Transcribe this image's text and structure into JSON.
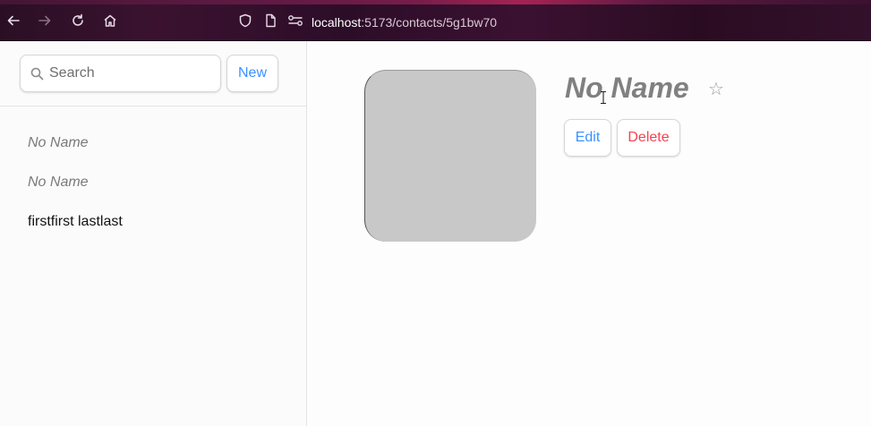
{
  "browser": {
    "url_host": "localhost",
    "url_path": ":5173/contacts/5g1bw70",
    "icons": [
      "back-arrow-icon",
      "forward-arrow-icon",
      "reload-icon",
      "home-icon",
      "shield-icon",
      "page-icon",
      "permissions-icon"
    ]
  },
  "sidebar": {
    "search_placeholder": "Search",
    "new_label": "New",
    "contacts": [
      {
        "label": "No Name",
        "no_name": true
      },
      {
        "label": "No Name",
        "no_name": true
      },
      {
        "label": "firstfirst lastlast",
        "no_name": false
      }
    ]
  },
  "detail": {
    "name": "No Name",
    "favorite_glyph": "☆",
    "edit_label": "Edit",
    "delete_label": "Delete"
  },
  "colors": {
    "accent": "#3992ff",
    "danger": "#f44250",
    "avatar_bg": "#c8c8c8",
    "muted_text": "#808080"
  }
}
